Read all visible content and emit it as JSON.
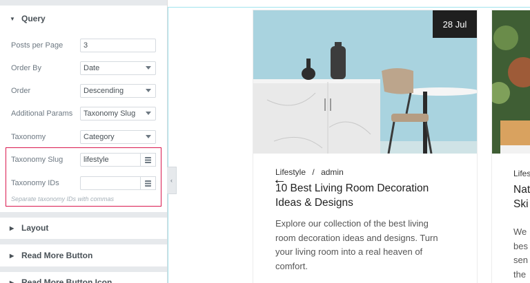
{
  "sidebar": {
    "query_section": {
      "label": "Query"
    },
    "fields": [
      {
        "label": "Posts per Page",
        "value": "3"
      },
      {
        "label": "Order By",
        "value": "Date"
      },
      {
        "label": "Order",
        "value": "Descending"
      },
      {
        "label": "Additional Params",
        "value": "Taxonomy Slug"
      },
      {
        "label": "Taxonomy",
        "value": "Category"
      }
    ],
    "taxonomy_slug": {
      "label": "Taxonomy Slug",
      "value": "lifestyle"
    },
    "taxonomy_ids": {
      "label": "Taxonomy IDs",
      "value": ""
    },
    "hint": "Separate taxonomy IDs with commas",
    "sections": [
      {
        "label": "Layout"
      },
      {
        "label": "Read More Button"
      },
      {
        "label": "Read More Button Icon"
      }
    ],
    "highlight_color": "#d9174e"
  },
  "preview": {
    "card1": {
      "date": "28 Jul",
      "category": "Lifestyle",
      "separator": "/",
      "author": "admin",
      "title_line1": "10 Best Living Room Decoration",
      "title_line2": "Ideas & Designs",
      "excerpt_line1": "Explore our collection of the best living",
      "excerpt_line2": "room decoration ideas and designs. Turn",
      "excerpt_line3": "your living room into a real heaven of",
      "excerpt_line4": "comfort."
    },
    "card2": {
      "meta": "Lifes",
      "title_line1": "Nat",
      "title_line2": "Ski",
      "excerpt_line1": "We",
      "excerpt_line2": "bes",
      "excerpt_line3": "sen",
      "excerpt_line4": "the"
    }
  }
}
